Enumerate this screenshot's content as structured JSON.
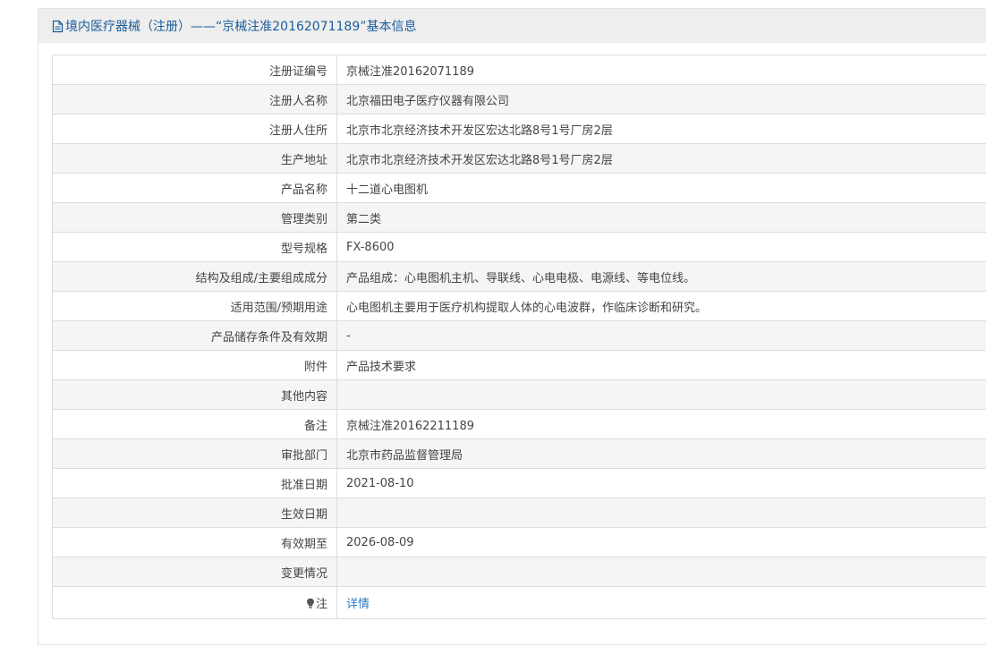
{
  "header": {
    "title": "境内医疗器械（注册）——“京械注准20162071189”基本信息"
  },
  "rows": [
    {
      "label": "注册证编号",
      "value": "京械注准20162071189"
    },
    {
      "label": "注册人名称",
      "value": "北京福田电子医疗仪器有限公司"
    },
    {
      "label": "注册人住所",
      "value": "北京市北京经济技术开发区宏达北路8号1号厂房2层"
    },
    {
      "label": "生产地址",
      "value": "北京市北京经济技术开发区宏达北路8号1号厂房2层"
    },
    {
      "label": "产品名称",
      "value": "十二道心电图机"
    },
    {
      "label": "管理类别",
      "value": "第二类"
    },
    {
      "label": "型号规格",
      "value": "FX-8600"
    },
    {
      "label": "结构及组成/主要组成成分",
      "value": "产品组成：心电图机主机、导联线、心电电极、电源线、等电位线。"
    },
    {
      "label": "适用范围/预期用途",
      "value": "心电图机主要用于医疗机构提取人体的心电波群，作临床诊断和研究。"
    },
    {
      "label": "产品储存条件及有效期",
      "value": "-"
    },
    {
      "label": "附件",
      "value": "产品技术要求"
    },
    {
      "label": "其他内容",
      "value": ""
    },
    {
      "label": "备注",
      "value": "京械注准20162211189"
    },
    {
      "label": "审批部门",
      "value": "北京市药品监督管理局"
    },
    {
      "label": "批准日期",
      "value": "2021-08-10"
    },
    {
      "label": "生效日期",
      "value": ""
    },
    {
      "label": "有效期至",
      "value": "2026-08-09"
    },
    {
      "label": "变更情况",
      "value": ""
    }
  ],
  "note": {
    "label": "注",
    "link_text": "详情",
    "icon": "lightbulb-icon"
  },
  "colors": {
    "title": "#1a5c9c",
    "link": "#2f78bd",
    "header_bg": "#eeeeee",
    "alt_row_bg": "#f5f5f5",
    "border": "#dddddd"
  }
}
